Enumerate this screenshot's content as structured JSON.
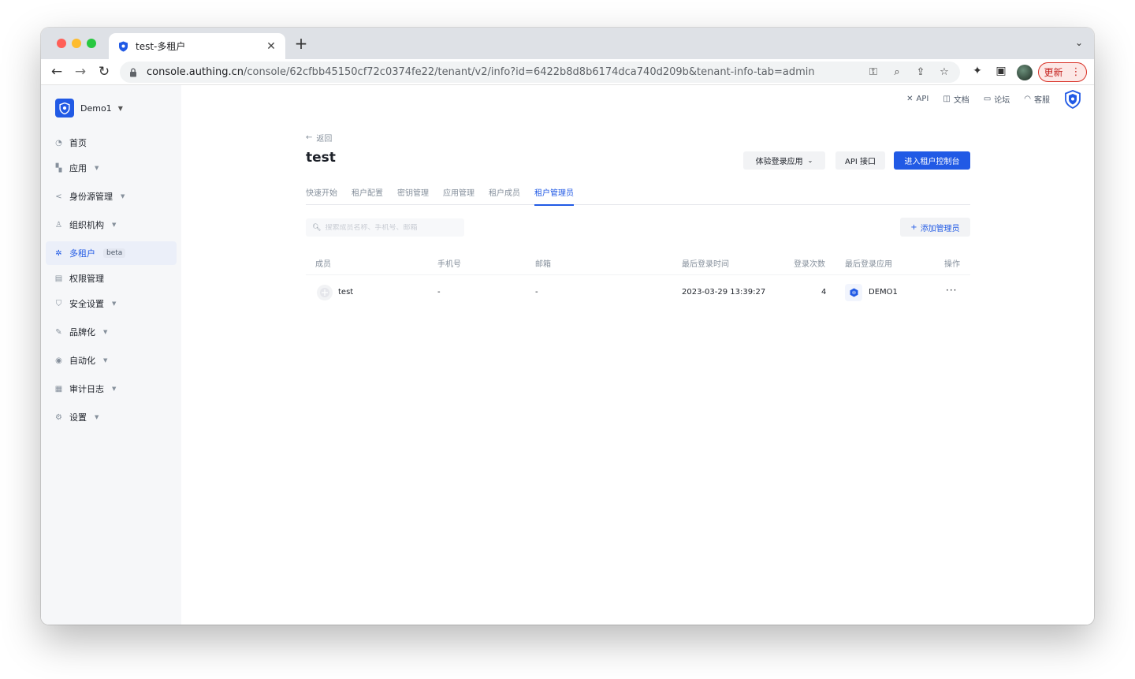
{
  "browser": {
    "tab_title": "test-多租户",
    "url_host": "console.authing.cn",
    "url_path": "/console/62cfbb45150cf72c0374fe22/tenant/v2/info?id=6422b8d8b6174dca740d209b&tenant-info-tab=admin",
    "update_label": "更新"
  },
  "sidebar": {
    "org_name": "Demo1",
    "items": [
      {
        "label": "首页",
        "icon": "pie-chart-icon"
      },
      {
        "label": "应用",
        "icon": "apps-grid-icon"
      },
      {
        "label": "身份源管理",
        "icon": "share-nodes-icon"
      },
      {
        "label": "组织机构",
        "icon": "org-tree-icon"
      },
      {
        "label": "多租户",
        "icon": "tenant-icon",
        "badge": "beta"
      },
      {
        "label": "权限管理",
        "icon": "lock-icon"
      },
      {
        "label": "安全设置",
        "icon": "shield-icon"
      },
      {
        "label": "品牌化",
        "icon": "brush-icon"
      },
      {
        "label": "自动化",
        "icon": "automation-icon"
      },
      {
        "label": "审计日志",
        "icon": "log-icon"
      },
      {
        "label": "设置",
        "icon": "settings-icon"
      }
    ]
  },
  "top_links": {
    "api": "API",
    "docs": "文档",
    "forum": "论坛",
    "support": "客服"
  },
  "page": {
    "back": "返回",
    "title": "test",
    "btn_try": "体验登录应用",
    "btn_api": "API 接口",
    "btn_enter": "进入租户控制台"
  },
  "tabs": [
    "快速开始",
    "租户配置",
    "密钥管理",
    "应用管理",
    "租户成员",
    "租户管理员"
  ],
  "search": {
    "placeholder": "搜索成员名称、手机号、邮箱"
  },
  "add_admin": "添加管理员",
  "table": {
    "columns": [
      "成员",
      "手机号",
      "邮箱",
      "最后登录时间",
      "登录次数",
      "最后登录应用",
      "操作"
    ],
    "rows": [
      {
        "member": "test",
        "phone": "-",
        "email": "-",
        "last_login": "2023-03-29 13:39:27",
        "count": "4",
        "app": "DEMO1",
        "action": "···"
      }
    ]
  },
  "colors": {
    "primary": "#215ae5",
    "sidebar_bg": "#f6f7f9",
    "active_bg": "#ebeff9"
  }
}
